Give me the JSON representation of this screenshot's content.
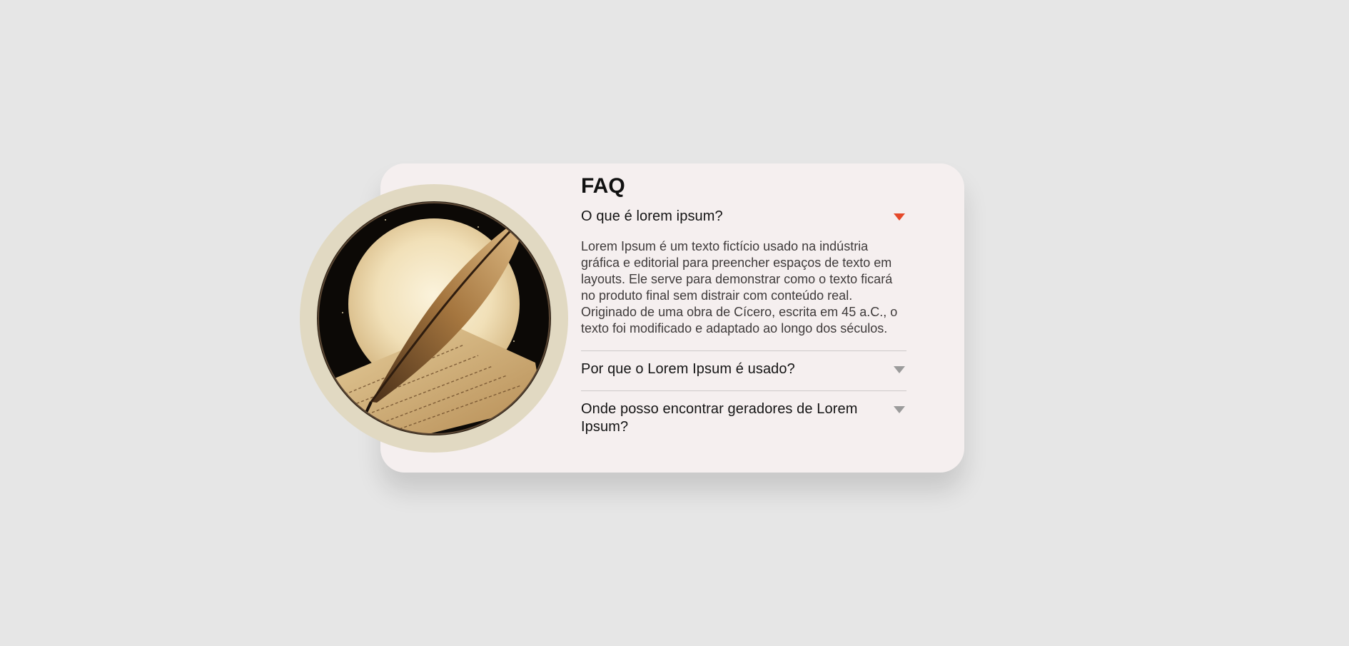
{
  "faq": {
    "title": "FAQ",
    "accent_color": "#e5492a",
    "caret_color": "#9b9b9b",
    "items": [
      {
        "question": "O que é lorem ipsum?",
        "expanded": true,
        "answer": "Lorem Ipsum é um texto fictício usado na indústria gráfica e editorial para preencher espaços de texto em layouts. Ele serve para demonstrar como o texto ficará no produto final sem distrair com conteúdo real. Originado de uma obra de Cícero, escrita em 45 a.C., o texto foi modificado e adaptado ao longo dos séculos."
      },
      {
        "question": "Por que o Lorem Ipsum é usado?",
        "expanded": false
      },
      {
        "question": "Onde posso encontrar geradores de Lorem Ipsum?",
        "expanded": false
      }
    ]
  },
  "illustration": {
    "subject": "quill-and-parchment",
    "frame_color": "#e1d9c2"
  }
}
